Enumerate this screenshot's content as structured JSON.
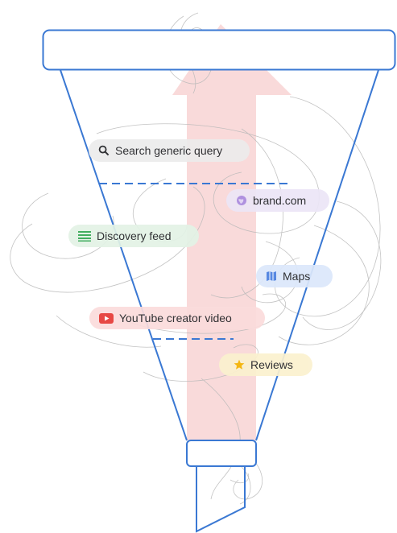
{
  "colors": {
    "funnel_stroke": "#3a78d3",
    "arrow_fill": "#f8d4d4",
    "scribble_stroke": "#b9b9b9",
    "search_chip_bg": "#ececec",
    "brand_chip_bg": "#ece6f7",
    "discovery_chip_bg": "#e3f3e6",
    "maps_chip_bg": "#dce8fb",
    "youtube_chip_bg": "#fbdcdc",
    "reviews_chip_bg": "#fbf1cf"
  },
  "chips": {
    "search": {
      "label": "Search generic query",
      "icon": "search-icon"
    },
    "brand": {
      "label": "brand.com",
      "icon": "globe-icon"
    },
    "discovery": {
      "label": "Discovery feed",
      "icon": "feed-lines-icon"
    },
    "maps": {
      "label": "Maps",
      "icon": "map-icon"
    },
    "youtube": {
      "label": "YouTube creator video",
      "icon": "youtube-play-icon"
    },
    "reviews": {
      "label": "Reviews",
      "icon": "star-icon"
    }
  }
}
